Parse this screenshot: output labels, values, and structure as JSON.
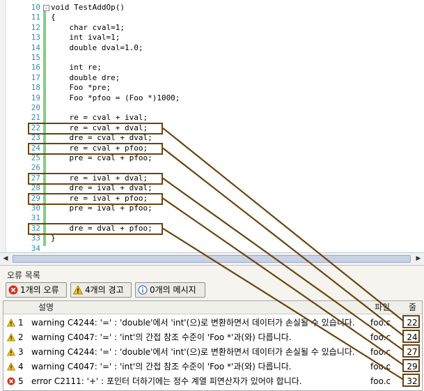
{
  "editor": {
    "lines": [
      {
        "n": "10",
        "code": "void TestAddOp()",
        "fold": "-"
      },
      {
        "n": "11",
        "code": "{"
      },
      {
        "n": "12",
        "code": "    char cval=1;"
      },
      {
        "n": "13",
        "code": "    int ival=1;"
      },
      {
        "n": "14",
        "code": "    double dval=1.0;"
      },
      {
        "n": "15",
        "code": ""
      },
      {
        "n": "16",
        "code": "    int re;"
      },
      {
        "n": "17",
        "code": "    double dre;"
      },
      {
        "n": "18",
        "code": "    Foo *pre;"
      },
      {
        "n": "19",
        "code": "    Foo *pfoo = (Foo *)1000;"
      },
      {
        "n": "20",
        "code": ""
      },
      {
        "n": "21",
        "code": "    re = cval + ival;"
      },
      {
        "n": "22",
        "code": "    re = cval + dval;"
      },
      {
        "n": "23",
        "code": "    dre = cval + dval;"
      },
      {
        "n": "24",
        "code": "    re = cval + pfoo;"
      },
      {
        "n": "25",
        "code": "    pre = cval + pfoo;"
      },
      {
        "n": "26",
        "code": ""
      },
      {
        "n": "27",
        "code": "    re = ival + dval;"
      },
      {
        "n": "28",
        "code": "    dre = ival + dval;"
      },
      {
        "n": "29",
        "code": "    re = ival + pfoo;"
      },
      {
        "n": "30",
        "code": "    pre = ival + pfoo;"
      },
      {
        "n": "31",
        "code": ""
      },
      {
        "n": "32",
        "code": "    dre = dval + pfoo;"
      },
      {
        "n": "33",
        "code": "}"
      },
      {
        "n": "34",
        "code": ""
      }
    ]
  },
  "error_list": {
    "title": "오류 목록",
    "errors_button": "1개의 오류",
    "warnings_button": "4개의 경고",
    "messages_button": "0개의 메시지",
    "columns": {
      "description": "설명",
      "file": "파일",
      "line": "줄"
    },
    "rows": [
      {
        "type": "warning",
        "n": "1",
        "desc": "warning C4244: '=' : 'double'에서 'int'(으)로 변환하면서 데이터가 손실될 수 있습니다.",
        "file": "foo.c",
        "line": "22"
      },
      {
        "type": "warning",
        "n": "2",
        "desc": "warning C4047: '=' : 'int'의 간접 참조 수준이 'Foo *'과(와) 다릅니다.",
        "file": "foo.c",
        "line": "24"
      },
      {
        "type": "warning",
        "n": "3",
        "desc": "warning C4244: '=' : 'double'에서 'int'(으)로 변환하면서 데이터가 손실될 수 있습니다.",
        "file": "foo.c",
        "line": "27"
      },
      {
        "type": "warning",
        "n": "4",
        "desc": "warning C4047: '=' : 'int'의 간접 참조 수준이 'Foo *'과(와) 다릅니다.",
        "file": "foo.c",
        "line": "29"
      },
      {
        "type": "error",
        "n": "5",
        "desc": "error C2111: '+' : 포인터 더하기에는 정수 계열 피연산자가 있어야 합니다.",
        "file": "foo.c",
        "line": "32"
      }
    ]
  },
  "colors": {
    "annotation": "#6b4310",
    "line_number": "#2b91af",
    "change_bar": "#7fd27f"
  }
}
